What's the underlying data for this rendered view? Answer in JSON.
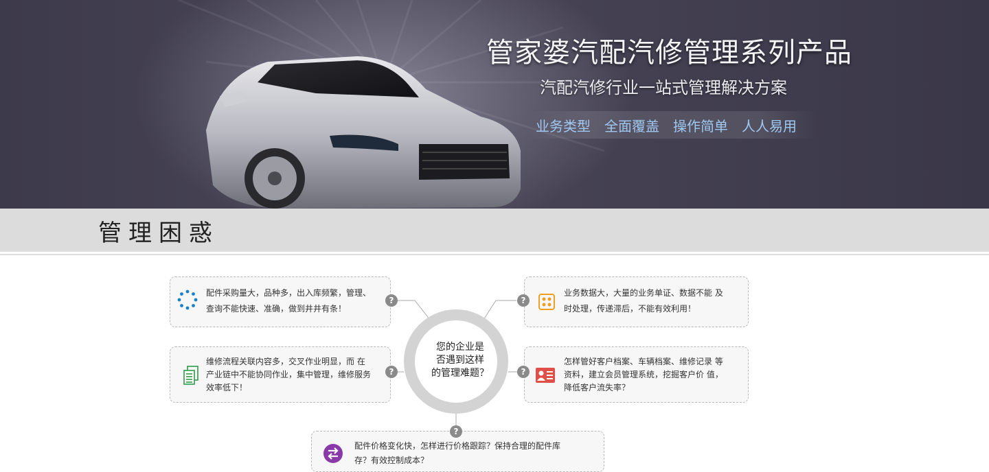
{
  "banner": {
    "title": "管家婆汽配汽修管理系列产品",
    "subtitle": "汽配汽修行业一站式管理解决方案",
    "tags": [
      "业务类型",
      "全面覆盖",
      "操作简单",
      "人人易用"
    ]
  },
  "section": {
    "title": "管理困惑"
  },
  "center": {
    "line1": "您的企业是",
    "line2": "否遇到这样",
    "line3": "的管理难题？"
  },
  "question_mark": "?",
  "problems": {
    "top_left": {
      "icon": "dotted-circle-icon",
      "line1": "配件采购量大，品种多，出入库频繁，管理、",
      "line2": "查询不能快速、准确，做到井井有条！"
    },
    "top_right": {
      "icon": "grid-dots-icon",
      "line1": "业务数据大，大量的业务单证、数据不能 及",
      "line2": "时处理，传递滞后，不能有效利用！"
    },
    "mid_left": {
      "icon": "documents-icon",
      "line1": "维修流程关联内容多，交叉作业明显，而 在",
      "line2": "产业链中不能协同作业，集中管理，维修服务",
      "line3": "效率低下！"
    },
    "mid_right": {
      "icon": "customer-card-icon",
      "line1": "怎样管好客户档案、车辆档案、维修记录 等",
      "line2": "资料，建立会员管理系统，挖掘客户价 值，",
      "line3": "降低客户流失率？"
    },
    "bottom": {
      "icon": "price-exchange-icon",
      "line1": "配件价格变化快，怎样进行价格跟踪？保持合理的配件库",
      "line2": "存？有效控制成本？"
    }
  },
  "colors": {
    "banner_bg": "#3d3a4b",
    "tag_blue": "#9fc8f0",
    "section_bg": "#dcdcdc",
    "icon_blue": "#1a7fc9",
    "icon_orange": "#f0a020",
    "icon_green": "#2e9a48",
    "icon_red": "#e0504a",
    "icon_purple": "#8a3aa8"
  }
}
